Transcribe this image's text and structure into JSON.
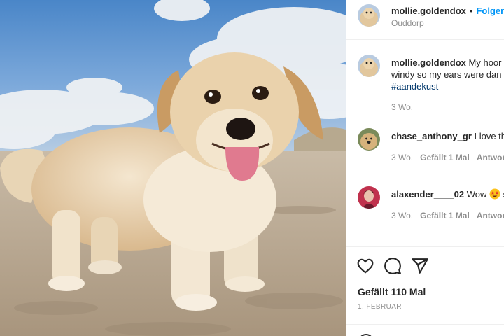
{
  "post": {
    "username": "mollie.goldendox",
    "follow_label": "Folgen",
    "location": "Ouddorp",
    "caption_user": "mollie.goldendox",
    "caption_line1": "My hoor",
    "caption_line2": "windy so my ears were dan",
    "hashtag": "#aandekust",
    "caption_time": "3 Wo."
  },
  "comments": [
    {
      "user": "chase_anthony_gr",
      "text": "I love th",
      "time": "3 Wo.",
      "likes": "Gefällt 1 Mal",
      "reply": "Antwort"
    },
    {
      "user": "alaxender____02",
      "text": "Wow",
      "suffix": "s",
      "time": "3 Wo.",
      "likes": "Gefällt 1 Mal",
      "reply": "Antwort"
    }
  ],
  "actions": {
    "like_icon": "heart-icon",
    "comment_icon": "comment-icon",
    "share_icon": "share-icon",
    "likes_text": "Gefällt 110 Mal",
    "date": "1. FEBRUAR"
  },
  "colors": {
    "accent": "#0095f6",
    "hashtag": "#00376b",
    "muted": "#8e8e8e",
    "text": "#262626"
  }
}
